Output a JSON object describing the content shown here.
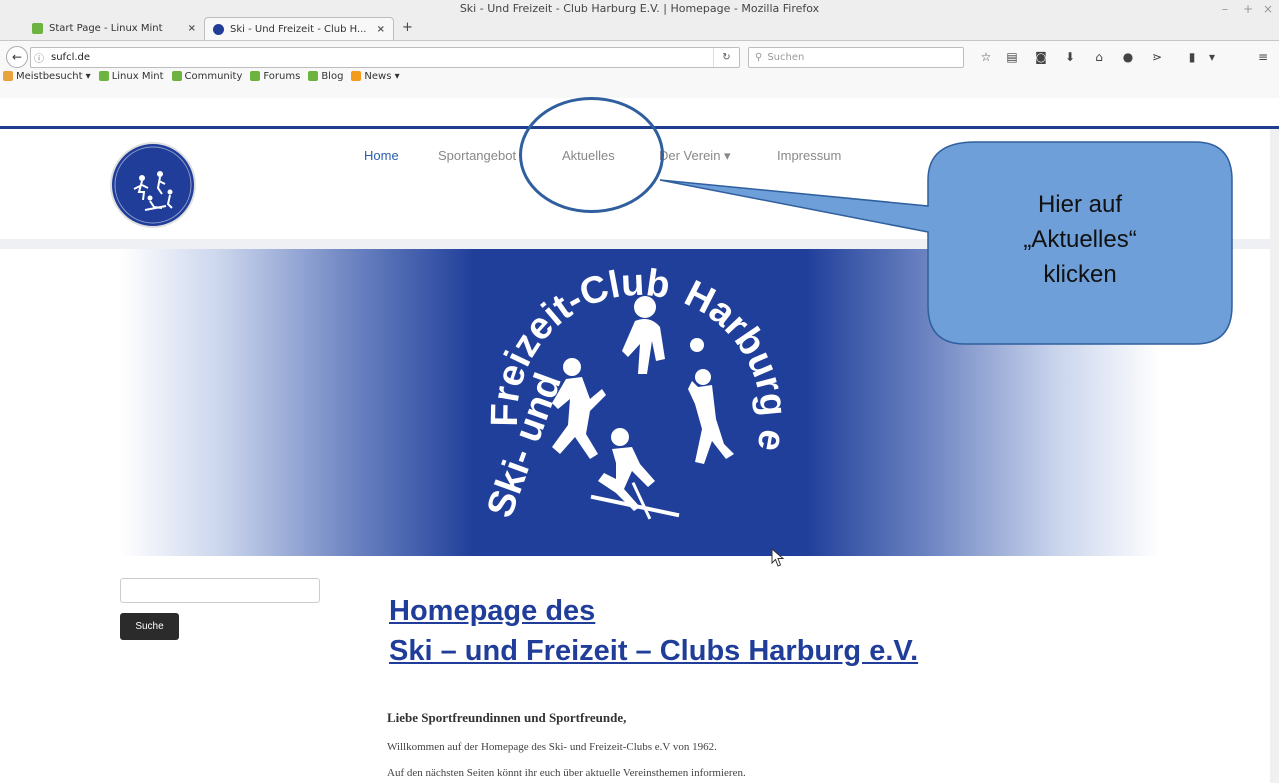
{
  "window": {
    "title": "Ski - Und Freizeit - Club Harburg E.V. | Homepage - Mozilla Firefox",
    "controls": [
      "–",
      "+",
      "×"
    ]
  },
  "tabs": [
    {
      "label": "Start Page - Linux Mint",
      "active": false
    },
    {
      "label": "Ski - Und Freizeit - Club H...",
      "active": true
    }
  ],
  "tab_close": "×",
  "new_tab": "+",
  "navbar": {
    "back": "←",
    "info": "ⓘ",
    "url": "sufcl.de",
    "reload": "↻",
    "search_placeholder": "Suchen"
  },
  "toolbar_icons": [
    "star-icon",
    "reading-list-icon",
    "pocket-icon",
    "download-icon",
    "home-icon",
    "chat-icon",
    "share-icon",
    "battery-icon",
    "menu-icon"
  ],
  "toolbar_glyphs": [
    "☆",
    "▤",
    "◙",
    "⬇",
    "⌂",
    "●",
    "⋗",
    "▮",
    "≡"
  ],
  "bookmarks": [
    {
      "label": "Meistbesucht ▾",
      "color": "#e8a33d"
    },
    {
      "label": "Linux Mint",
      "color": "#6db33f"
    },
    {
      "label": "Community",
      "color": "#6db33f"
    },
    {
      "label": "Forums",
      "color": "#6db33f"
    },
    {
      "label": "Blog",
      "color": "#6db33f"
    },
    {
      "label": "News ▾",
      "color": "#f29b1d"
    }
  ],
  "site_nav": [
    {
      "label": "Home",
      "active": true
    },
    {
      "label": "Sportangebot",
      "active": false
    },
    {
      "label": "Aktuelles",
      "active": false
    },
    {
      "label": "Der Verein ▾",
      "active": false
    },
    {
      "label": "Impressum",
      "active": false
    }
  ],
  "banner": {
    "ring_text_left": "Freizeit-Club",
    "ring_text_right": "Harburg e.V.",
    "ring_text_bottom": "Ski- und"
  },
  "sidebar": {
    "search_button": "Suche"
  },
  "main": {
    "title_line1": "Homepage des",
    "title_line2": "Ski – und Freizeit – Clubs Harburg e.V.",
    "greeting": "Liebe Sportfreundinnen und Sportfreunde,",
    "paragraph1": "Willkommen auf der Homepage des Ski- und Freizeit-Clubs e.V von 1962.",
    "paragraph2": "Auf den nächsten Seiten könnt ihr euch über aktuelle Vereinsthemen informieren."
  },
  "callout": {
    "line1": "Hier auf",
    "line2": "„Aktuelles“",
    "line3": "klicken",
    "fill_color": "#6f9fd8",
    "ring_color": "#2f5f9e"
  },
  "colors": {
    "brand_blue": "#1f3d99",
    "link_blue": "#2a5db0"
  }
}
